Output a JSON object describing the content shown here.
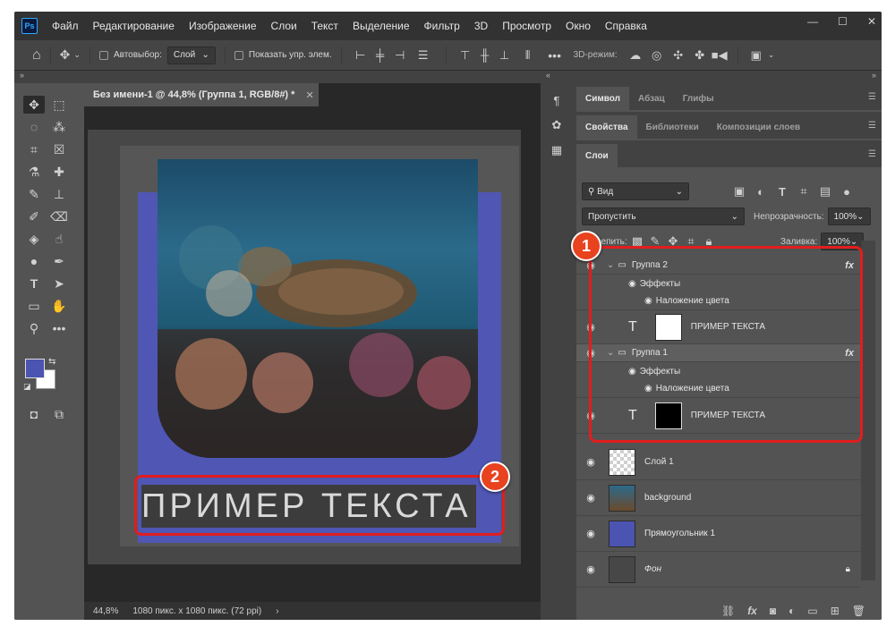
{
  "app": {
    "logo": "Ps"
  },
  "menu": [
    "Файл",
    "Редактирование",
    "Изображение",
    "Слои",
    "Текст",
    "Выделение",
    "Фильтр",
    "3D",
    "Просмотр",
    "Окно",
    "Справка"
  ],
  "options": {
    "autoselect_label": "Автовыбор:",
    "autoselect_value": "Слой",
    "show_controls_label": "Показать упр. элем.",
    "mode3d_label": "3D-режим:"
  },
  "document": {
    "tab_title": "Без имени-1 @ 44,8% (Группа 1, RGB/8#) *",
    "canvas_text": "ПРИМЕР ТЕКСТА",
    "zoom": "44,8%",
    "doc_info": "1080 пикс. x 1080 пикс. (72 ppi)"
  },
  "panels": {
    "tabs_row1": [
      "Символ",
      "Абзац",
      "Глифы"
    ],
    "tabs_row2": [
      "Свойства",
      "Библиотеки",
      "Композиции слоев"
    ],
    "tabs_row3": [
      "Слои"
    ],
    "filter_kind": "Вид",
    "blend_mode": "Пропустить",
    "opacity_label": "Непрозрачность:",
    "opacity_value": "100%",
    "lock_label": "Закрепить:",
    "fill_label": "Заливка:",
    "fill_value": "100%"
  },
  "layers": [
    {
      "name": "Группа 2",
      "kind": "group"
    },
    {
      "name": "Эффекты",
      "kind": "effects"
    },
    {
      "name": "Наложение цвета",
      "kind": "effect"
    },
    {
      "name": "ПРИМЕР ТЕКСТА",
      "kind": "text",
      "thumb_color": "#ffffff"
    },
    {
      "name": "Группа 1",
      "kind": "group"
    },
    {
      "name": "Эффекты",
      "kind": "effects"
    },
    {
      "name": "Наложение цвета",
      "kind": "effect"
    },
    {
      "name": "ПРИМЕР ТЕКСТА",
      "kind": "text",
      "thumb_color": "#000000"
    },
    {
      "name": "Слой 1",
      "kind": "pixel"
    },
    {
      "name": "background",
      "kind": "smart"
    },
    {
      "name": "Прямоугольник 1",
      "kind": "shape"
    },
    {
      "name": "Фон",
      "kind": "locked"
    }
  ],
  "annotations": {
    "badge1": "1",
    "badge2": "2"
  },
  "colors": {
    "foreground": "#4b54b0",
    "background": "#ffffff",
    "highlight": "#e21d1d",
    "badge": "#e8421f"
  },
  "icons": {
    "fx": "fx"
  }
}
